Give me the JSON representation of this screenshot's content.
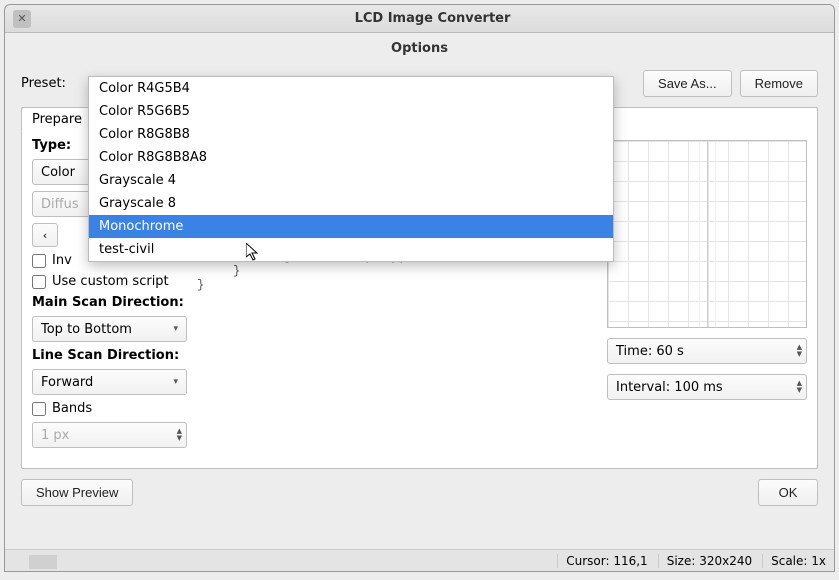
{
  "window": {
    "title": "LCD Image Converter",
    "subtitle": "Options"
  },
  "toolbar": {
    "preset_label": "Preset:",
    "save_as": "Save As...",
    "remove": "Remove"
  },
  "tabs": {
    "prepare": "Prepare"
  },
  "left": {
    "type_label": "Type:",
    "type_value": "Color",
    "dither_value": "Diffus",
    "inv": "Inv",
    "use_custom": "Use custom script",
    "main_scan": "Main Scan Direction:",
    "main_scan_value": "Top to Bottom",
    "line_scan": "Line Scan Direction:",
    "line_scan_value": "Forward",
    "bands": "Bands",
    "bands_px": "1 px"
  },
  "code": {
    "l1": "         image.addPoint(x, y);",
    "l2": "     }",
    "l3": "}"
  },
  "right": {
    "time": "Time: 60 s",
    "interval": "Interval: 100 ms"
  },
  "bottom": {
    "show_preview": "Show Preview",
    "ok": "OK"
  },
  "status": {
    "cursor": "Cursor: 116,1",
    "size": "Size: 320x240",
    "scale": "Scale: 1x"
  },
  "dropdown": {
    "items": [
      "Color R4G5B4",
      "Color R5G6B5",
      "Color R8G8B8",
      "Color R8G8B8A8",
      "Grayscale 4",
      "Grayscale 8",
      "Monochrome",
      "test-civil"
    ],
    "selected_index": 6
  }
}
